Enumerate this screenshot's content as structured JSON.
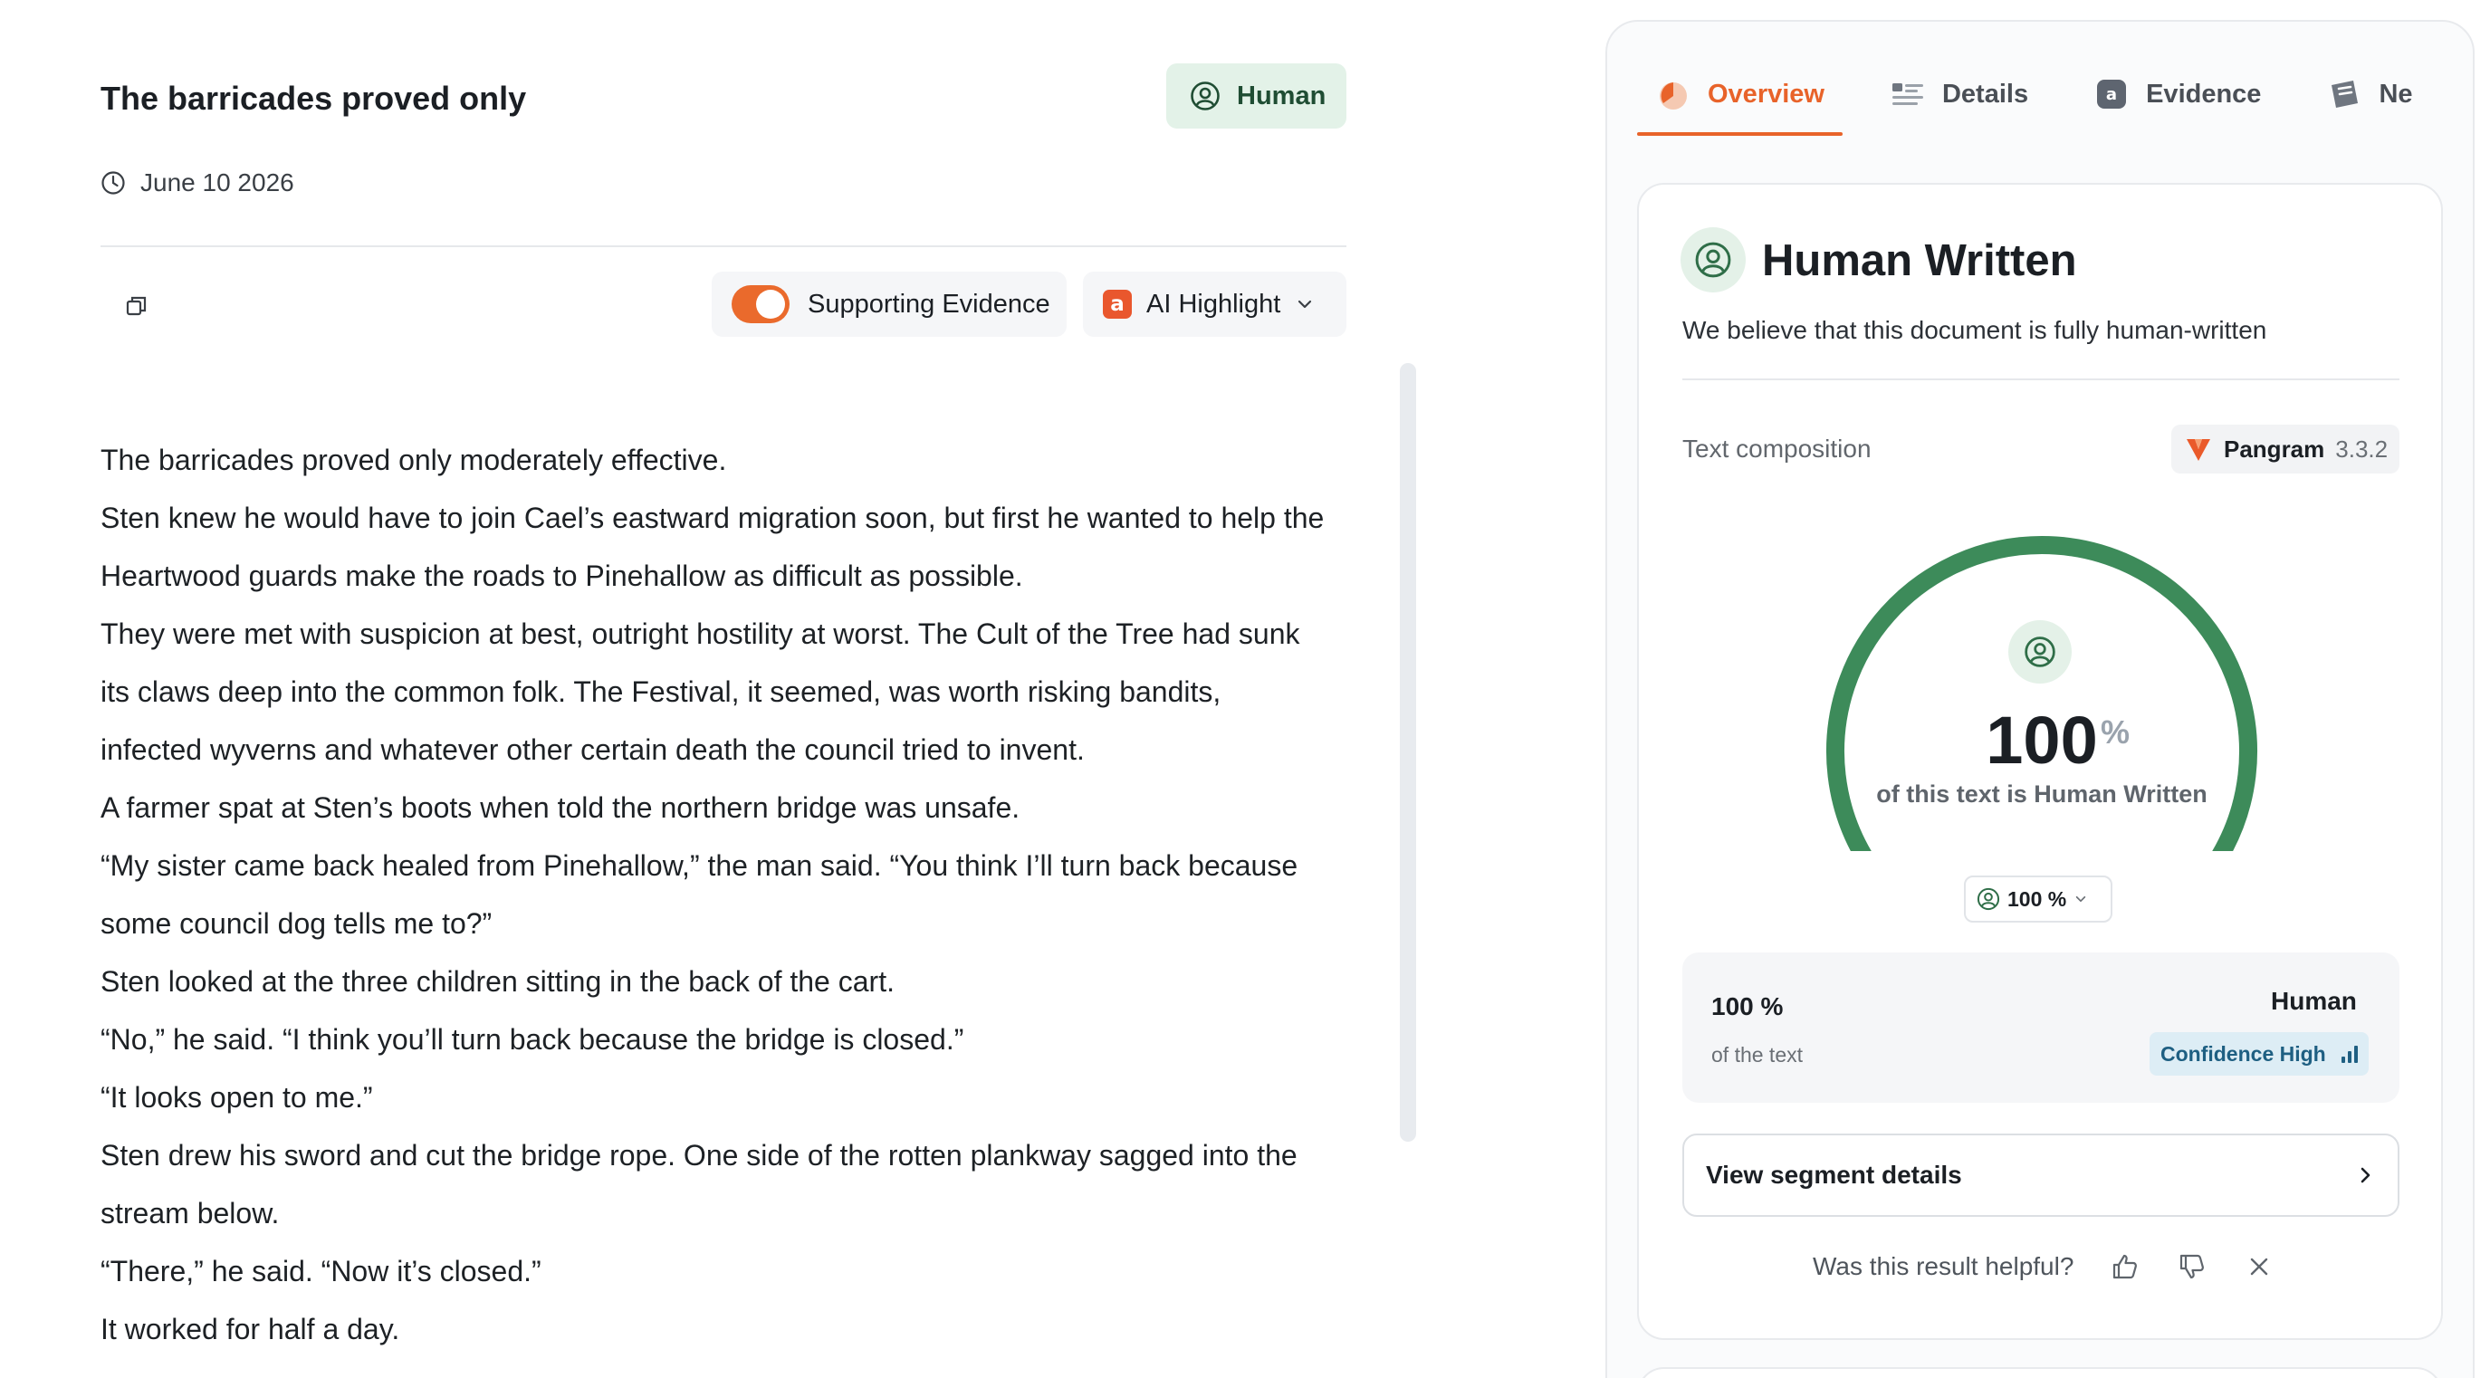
{
  "document": {
    "title": "The barricades proved only",
    "badge_label": "Human",
    "date": "June 10 2026",
    "toolbar": {
      "supporting_evidence_label": "Supporting Evidence",
      "supporting_evidence_on": true,
      "ai_highlight_label": "AI Highlight"
    },
    "paragraphs": [
      "The barricades proved only moderately effective.",
      "Sten knew he would have to join Cael’s eastward migration soon, but first he wanted to help the",
      "Heartwood guards make the roads to Pinehallow as difficult as possible.",
      "They were met with suspicion at best, outright hostility at worst. The Cult of the Tree had sunk",
      "its claws deep into the common folk. The Festival, it seemed, was worth risking bandits,",
      "infected wyverns and whatever other certain death the council tried to invent.",
      "A farmer spat at Sten’s boots when told the northern bridge was unsafe.",
      "“My sister came back healed from Pinehallow,” the man said. “You think I’ll turn back because",
      "some council dog tells me to?”",
      "Sten looked at the three children sitting in the back of the cart.",
      "“No,” he said. “I think you’ll turn back because the bridge is closed.”",
      "“It looks open to me.”",
      "Sten drew his sword and cut the bridge rope. One side of the rotten plankway sagged into the",
      "stream below.",
      "“There,” he said. “Now it’s closed.”",
      "It worked for half a day."
    ]
  },
  "panel": {
    "tabs": [
      {
        "label": "Overview",
        "icon": "pie-chart-icon",
        "active": true
      },
      {
        "label": "Details",
        "icon": "list-icon",
        "active": false
      },
      {
        "label": "Evidence",
        "icon": "evidence-icon",
        "active": false
      },
      {
        "label": "Ne",
        "icon": "news-icon",
        "active": false
      }
    ],
    "result_title": "Human Written",
    "result_subtitle": "We believe that this document is fully human-written",
    "text_composition_label": "Text composition",
    "model": {
      "name": "Pangram",
      "version": "3.3.2"
    },
    "gauge": {
      "value": "100",
      "fraction": 1.0,
      "unit": "%",
      "caption": "of this text is Human Written"
    },
    "select_value": "100 %",
    "summary": {
      "percent": "100 %",
      "of_text": "of the text",
      "label": "Human",
      "confidence": "Confidence High"
    },
    "segment_button_label": "View segment details",
    "feedback_question": "Was this result helpful?"
  },
  "colors": {
    "accent": "#e8632a",
    "human_green": "#3d8b5a",
    "human_bg": "#e4f1e8",
    "confidence_bg": "#ddedf5",
    "confidence_text": "#1e5f82"
  }
}
